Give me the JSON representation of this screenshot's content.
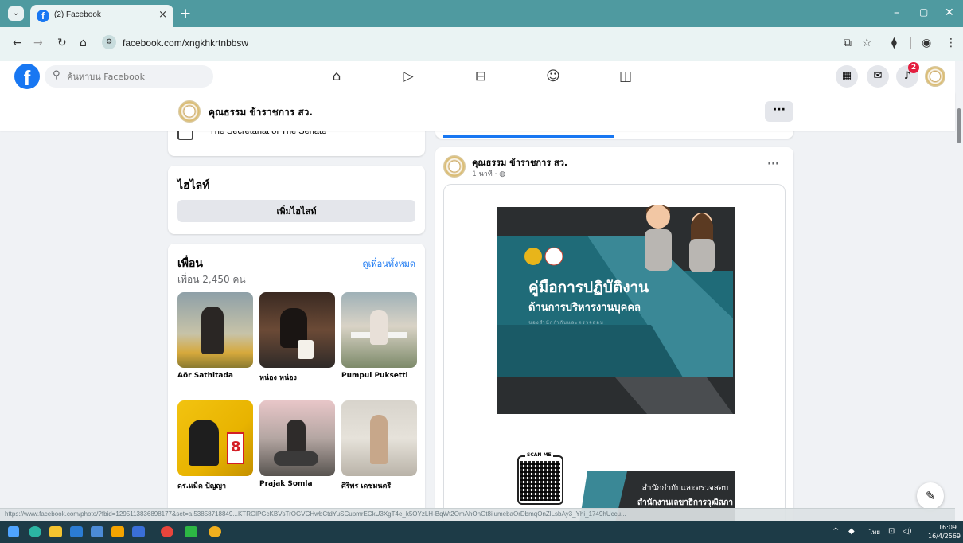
{
  "browser": {
    "tab_title": "(2) Facebook",
    "tab_close": "×",
    "new_tab": "+",
    "url": "facebook.com/xngkhkrtnbbsw",
    "status_url": "https://www.facebook.com/photo/?fbid=1295113836898177&set=a.53858718849...KTROlPGcKBVsTrOGVCHwbCtdYuSCupmrECkU3XgT4e_k5OYzLH-BqWt2OmAhOnOt8ilumebaOrDbmqOnZlLsbAy3_Yhi_1749hUccu..."
  },
  "fb": {
    "search_placeholder": "ค้นหาบน Facebook",
    "notifications_count": "2"
  },
  "profile": {
    "name": "คุณธรรม ข้าราชการ สว.",
    "more": "···"
  },
  "intro": {
    "workplace": "The Secretariat of The Senate"
  },
  "highlights": {
    "title": "ไฮไลท์",
    "add_button": "เพิ่มไฮไลท์"
  },
  "friends": {
    "title": "เพื่อน",
    "see_all": "ดูเพื่อนทั้งหมด",
    "count": "เพื่อน 2,450 คน",
    "items": [
      {
        "name": "Aör Sathitada"
      },
      {
        "name": "หน่อง หน่อง"
      },
      {
        "name": "Pumpui Puksetti"
      },
      {
        "name": "ดร.แม็ค ปัญญา"
      },
      {
        "name": "Prajak Somla"
      },
      {
        "name": "ศิริพร เดชมนตรี"
      }
    ]
  },
  "post": {
    "author": "คุณธรรม ข้าราชการ สว.",
    "time": "1 นาที · ◍",
    "more": "···",
    "poster": {
      "title_line1": "คู่มือการปฏิบัติงาน",
      "title_line2": "ด้านการบริหารงานบุคคล",
      "subtitle": "ของสำนักกำกับและตรวจสอบ",
      "scan_label": "SCAN ME",
      "org_line1": "สำนักกำกับและตรวจสอบ",
      "org_line2": "สำนักงานเลขาธิการวุฒิสภา"
    }
  },
  "taskbar": {
    "lang": "ไทย",
    "time": "16:09",
    "date": "16/4/2569"
  },
  "colors": {
    "fb_blue": "#1877f2",
    "chrome_teal": "#4f9aa0",
    "poster_teal": "#1f6b78",
    "poster_dark": "#2b2e30",
    "taskbar": "#1d3b47"
  }
}
